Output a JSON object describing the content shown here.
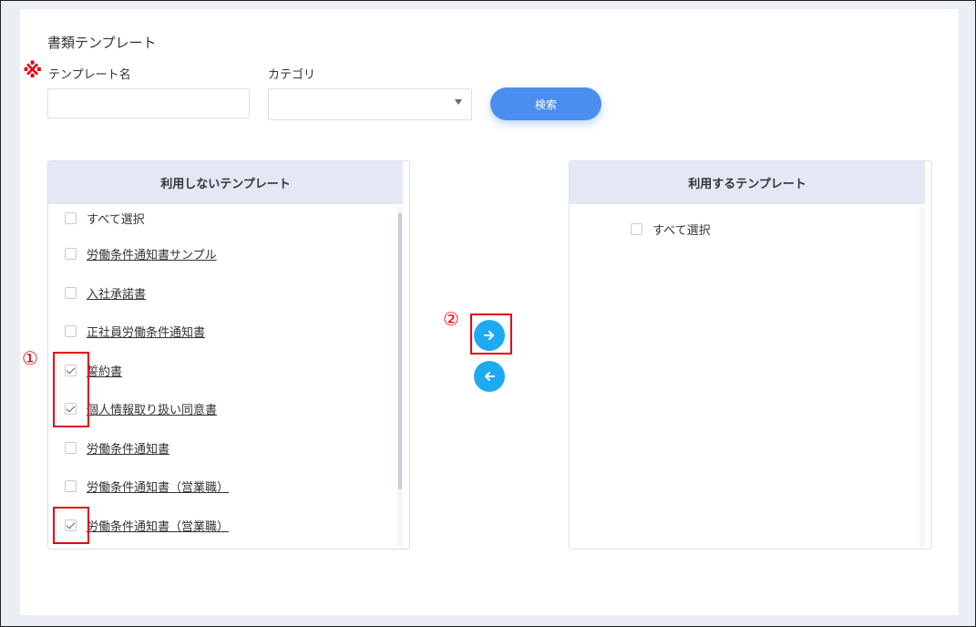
{
  "form": {
    "section_title": "書類テンプレート",
    "required_mark": "※",
    "name_label": "テンプレート名",
    "name_value": "",
    "category_label": "カテゴリ",
    "category_value": "",
    "search_label": "検索"
  },
  "left_panel": {
    "title": "利用しないテンプレート",
    "select_all": "すべて選択",
    "items": [
      {
        "label": "労働条件通知書サンプル",
        "checked": false
      },
      {
        "label": "入社承諾書",
        "checked": false
      },
      {
        "label": "正社員労働条件通知書",
        "checked": false
      },
      {
        "label": "誓約書",
        "checked": true
      },
      {
        "label": "個人情報取り扱い同意書",
        "checked": true
      },
      {
        "label": "労働条件通知書",
        "checked": false
      },
      {
        "label": "労働条件通知書（営業職）",
        "checked": false
      },
      {
        "label": "労働条件通知書（営業職）",
        "checked": true
      }
    ]
  },
  "right_panel": {
    "title": "利用するテンプレート",
    "select_all": "すべて選択"
  },
  "annotations": {
    "one": "①",
    "two": "②"
  },
  "colors": {
    "accent_blue": "#4a8ef0",
    "arrow_button": "#1eaaf1",
    "annotation_red": "#e60012",
    "panel_header": "#e4e8f5"
  },
  "icons": {
    "move_right": "arrow-right-icon",
    "move_left": "arrow-left-icon",
    "dropdown": "caret-down-icon"
  }
}
